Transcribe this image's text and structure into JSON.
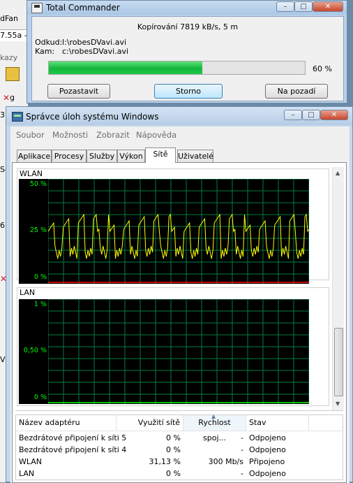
{
  "background_window": {
    "fragments": [
      "dFan",
      "7.55a -",
      "kazy",
      "g",
      "3",
      "Se",
      "6",
      "V"
    ]
  },
  "total_commander": {
    "title": "Total Commander",
    "status": "Kopírování 7819 kB/s, 5 m",
    "from_label": "Odkud:",
    "from_value": "l:\\robesDVavi.avi",
    "to_label": "Kam:",
    "to_value": "c:\\robesDVavi.avi",
    "progress": 0.6,
    "progress_text": "60 %",
    "buttons": {
      "pause": "Pozastavit",
      "cancel": "Storno",
      "background": "Na pozadí"
    },
    "window_controls": {
      "minimize": "–",
      "maximize": "□",
      "close": "✕"
    }
  },
  "task_manager": {
    "title": "Správce úloh systému Windows",
    "window_controls": {
      "minimize": "–",
      "maximize": "□",
      "close": "✕"
    },
    "menu": [
      "Soubor",
      "Možnosti",
      "Zobrazit",
      "Nápověda"
    ],
    "tabs": [
      "Aplikace",
      "Procesy",
      "Služby",
      "Výkon",
      "Sítě",
      "Uživatelé"
    ],
    "active_tab": "Sítě",
    "wlan_graph": {
      "label": "WLAN",
      "y_labels": [
        "50 %",
        "25 %",
        "0 %"
      ],
      "ylim": [
        0,
        50
      ]
    },
    "lan_graph": {
      "label": "LAN",
      "y_labels": [
        "1 %",
        "0,50 %",
        "0 %"
      ],
      "ylim": [
        0,
        1
      ]
    },
    "table": {
      "headers": [
        "Název adaptéru",
        "Využití sítě",
        "Rychlost spoj...",
        "Stav"
      ],
      "rows": [
        [
          "Bezdrátové připojení k síti 5",
          "0 %",
          "-",
          "Odpojeno"
        ],
        [
          "Bezdrátové připojení k síti 4",
          "0 %",
          "-",
          "Odpojeno"
        ],
        [
          "WLAN",
          "31,13 %",
          "300 Mb/s",
          "Připojeno"
        ],
        [
          "LAN",
          "0 %",
          "-",
          "Odpojeno"
        ]
      ]
    }
  },
  "colors": {
    "graph_line": "#ffff00",
    "graph_grid": "#008040",
    "progress_fill": "#22c94a",
    "zero_line": "#ff0000"
  }
}
